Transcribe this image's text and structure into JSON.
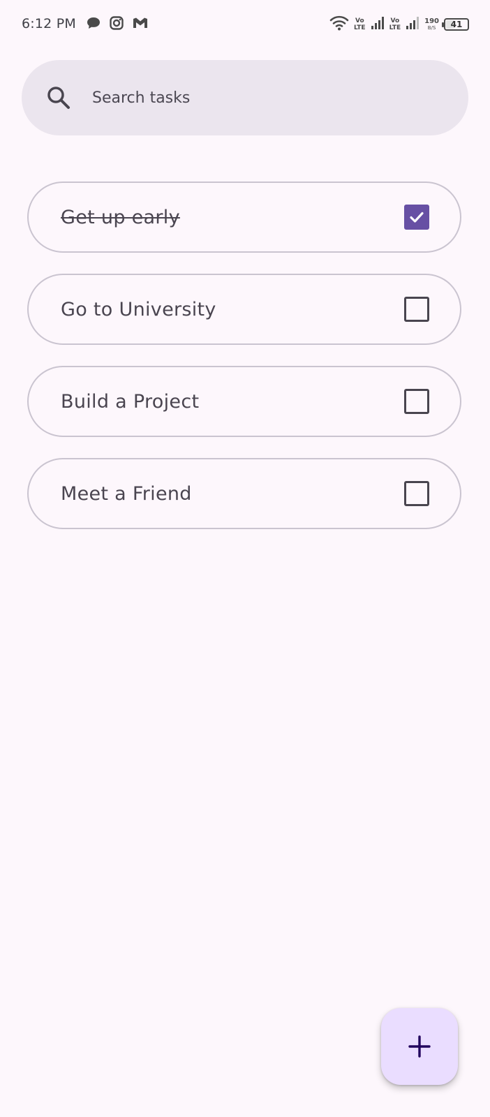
{
  "status_bar": {
    "time": "6:12 PM",
    "notification_icons": [
      "chat-bubble-icon",
      "instagram-icon",
      "gmail-icon"
    ],
    "volte_top": "Vo",
    "volte_bottom": "LTE",
    "net_speed_value": "190",
    "net_speed_unit": "B/S",
    "battery_level": "41",
    "battery_fraction": 0.41
  },
  "search": {
    "placeholder": "Search tasks",
    "value": ""
  },
  "tasks": [
    {
      "label": "Get up early",
      "done": true
    },
    {
      "label": "Go to University",
      "done": false
    },
    {
      "label": "Build a Project",
      "done": false
    },
    {
      "label": "Meet a Friend",
      "done": false
    }
  ],
  "fab": {
    "icon": "plus-icon"
  },
  "colors": {
    "background": "#fdf7fc",
    "search_background": "#ebe5ee",
    "checkbox_checked": "#6750a4",
    "fab_background": "#eaddff",
    "fab_icon": "#21005d",
    "outline": "#cac4d0"
  }
}
